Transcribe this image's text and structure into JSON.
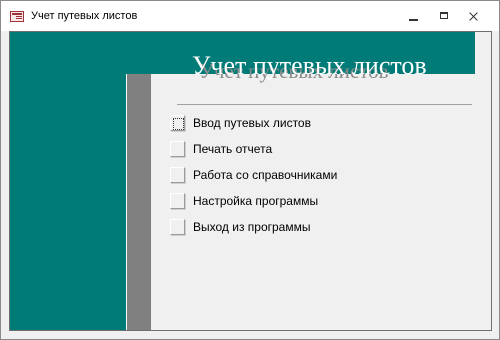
{
  "window": {
    "title": "Учет путевых листов"
  },
  "icons": {
    "app": "access-form-icon",
    "minimize": "minimize-icon",
    "maximize": "maximize-icon",
    "close": "close-icon"
  },
  "header": {
    "title": "Учет путевых листов",
    "shadow_text": "Учет путевых листов"
  },
  "colors": {
    "teal": "#007b77",
    "gray_bar": "#808080",
    "background": "#f0f0f0"
  },
  "menu": {
    "items": [
      {
        "label": "Ввод путевых листов",
        "focused": true
      },
      {
        "label": "Печать отчета",
        "focused": false
      },
      {
        "label": "Работа со справочниками",
        "focused": false
      },
      {
        "label": "Настройка программы",
        "focused": false
      },
      {
        "label": "Выход из программы",
        "focused": false
      }
    ]
  }
}
